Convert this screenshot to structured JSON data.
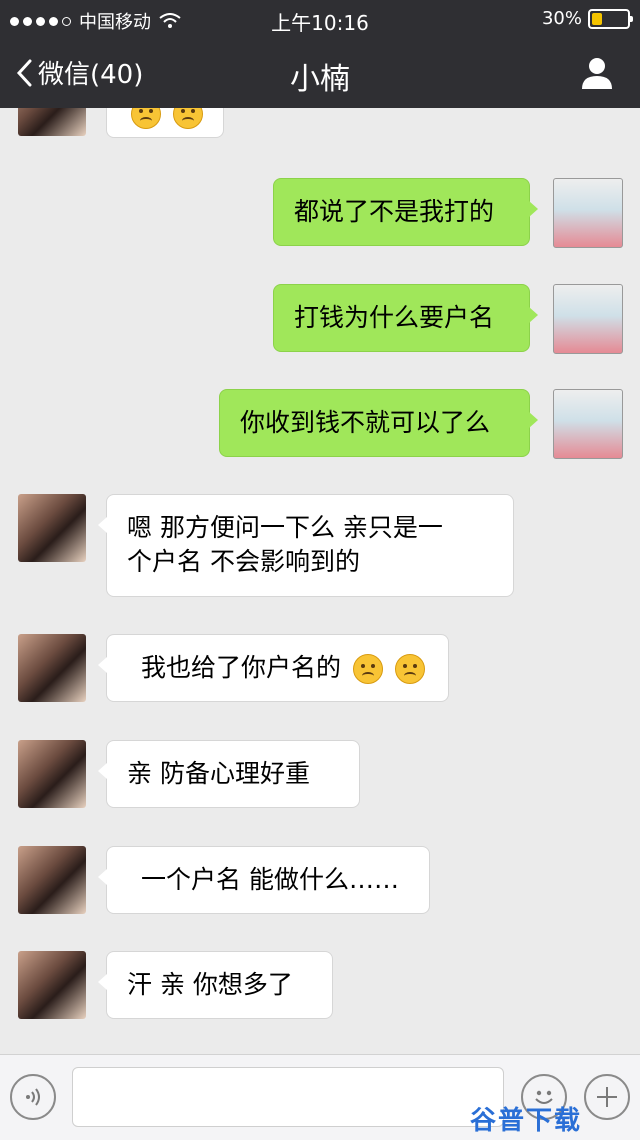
{
  "status": {
    "carrier": "中国移动",
    "time": "上午10:16",
    "battery": "30%",
    "battery_level": 0.3
  },
  "nav": {
    "back_label": "微信(40)",
    "title": "小楠"
  },
  "messages": [
    {
      "side": "me",
      "text": "都说了不是我打的"
    },
    {
      "side": "me",
      "text": "打钱为什么要户名"
    },
    {
      "side": "me",
      "text": "你收到钱不就可以了么"
    },
    {
      "side": "her",
      "line1": "嗯  那方便问一下么  亲只是一",
      "line2": "个户名  不会影响到的"
    },
    {
      "side": "her",
      "text": "我也给了你户名的"
    },
    {
      "side": "her",
      "text": "亲  防备心理好重"
    },
    {
      "side": "her",
      "text": "一个户名  能做什么……"
    },
    {
      "side": "her",
      "text": "汗  亲  你想多了"
    }
  ],
  "watermark": "谷普下载"
}
